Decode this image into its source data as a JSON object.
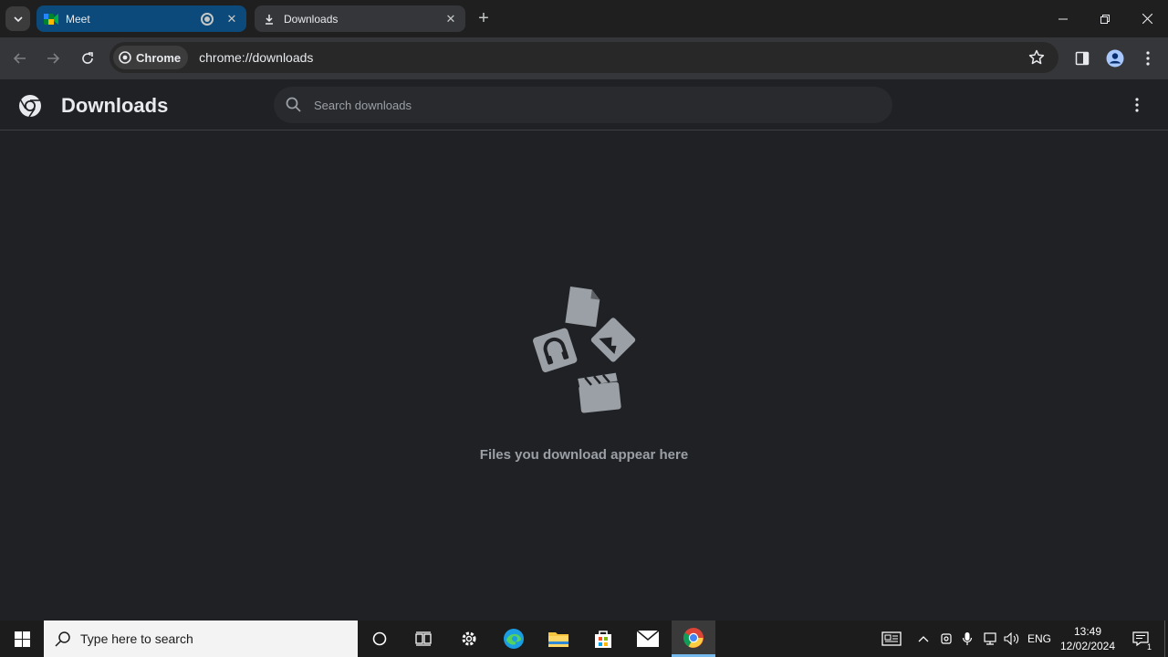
{
  "tabs": [
    {
      "title": "Meet",
      "icon": "google-meet-icon"
    },
    {
      "title": "Downloads",
      "icon": "download-icon"
    }
  ],
  "toolbar": {
    "chip_label": "Chrome",
    "url": "chrome://downloads"
  },
  "page": {
    "title": "Downloads",
    "search_placeholder": "Search downloads",
    "empty_message": "Files you download appear here"
  },
  "taskbar": {
    "search_placeholder": "Type here to search",
    "language": "ENG",
    "time": "13:49",
    "date": "12/02/2024",
    "notification_count": "1"
  },
  "colors": {
    "tab_strip": "#1f1f1f",
    "meet_tab": "#0b4a7a",
    "active_tab": "#35363a",
    "page_bg": "#202124",
    "taskbar": "#1c1c1c"
  }
}
